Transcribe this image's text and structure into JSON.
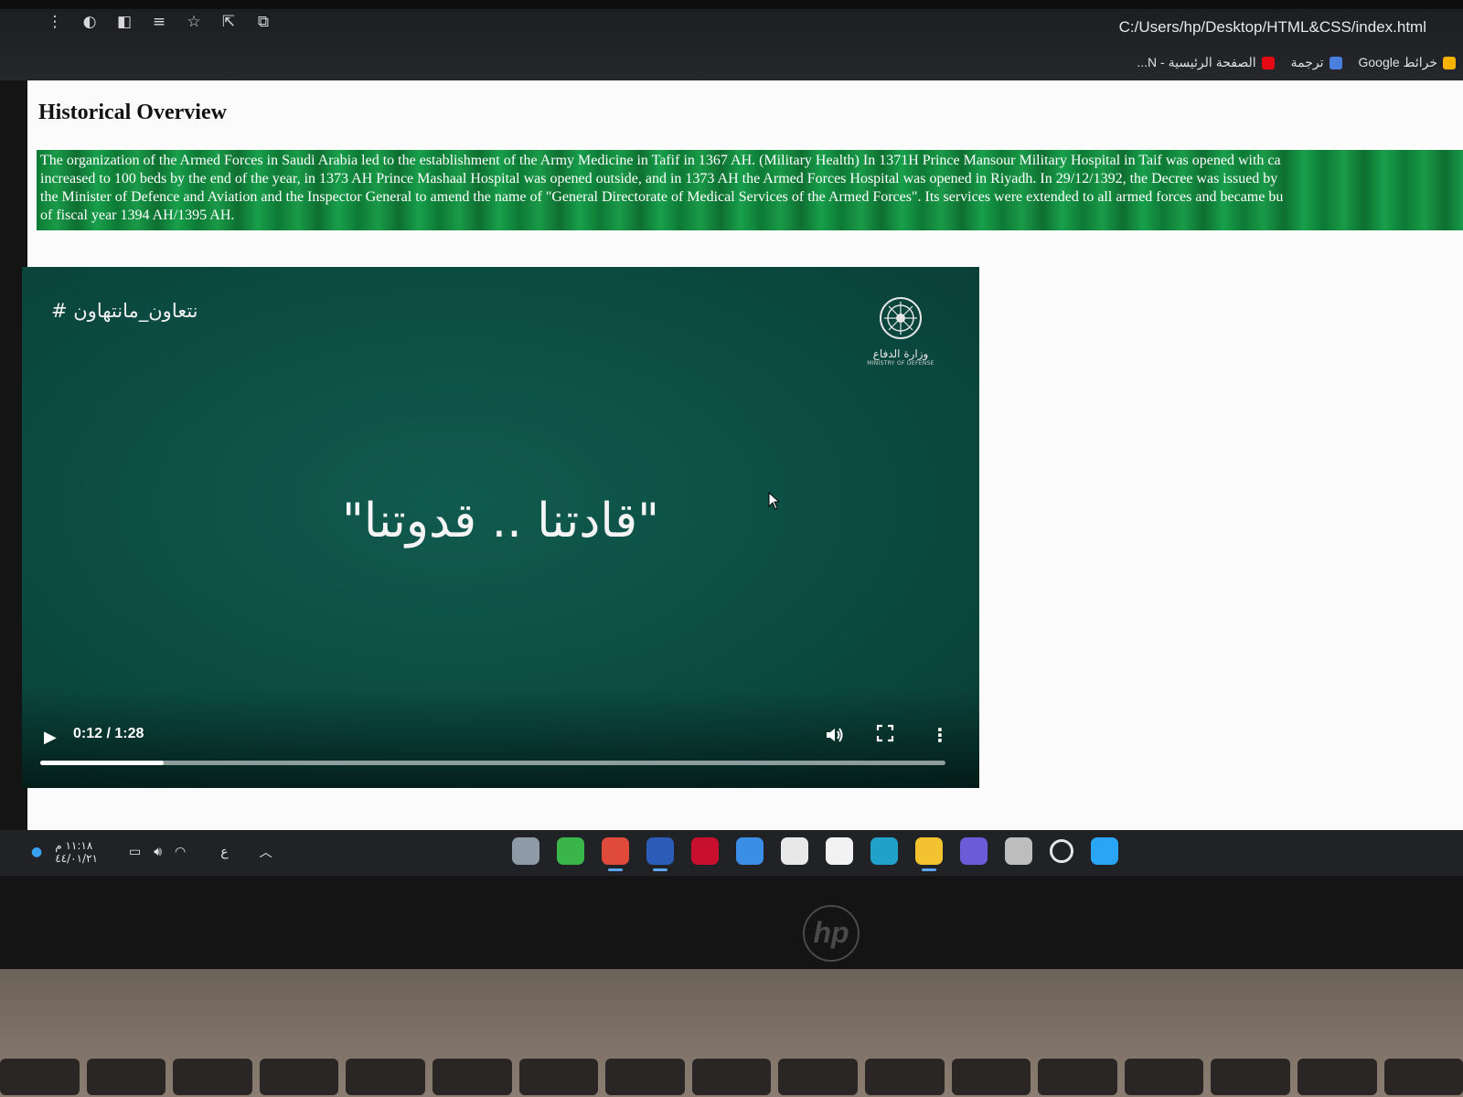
{
  "browser": {
    "address": "C:/Users/hp/Desktop/HTML&CSS/index.html",
    "bookmarks": [
      {
        "label": "خرائط Google",
        "color": "#f4b400"
      },
      {
        "label": "ترجمة",
        "color": "#4a7fe0"
      },
      {
        "label": "الصفحة الرئيسية - N...",
        "color": "#e50914"
      }
    ]
  },
  "page": {
    "heading": "Historical Overview",
    "paragraph": "The organization of the Armed Forces in Saudi Arabia led to the establishment of the Army Medicine in Tafif in 1367 AH. (Military Health) In 1371H Prince Mansour Military Hospital in Taif was opened with ca\nincreased to 100 beds by the end of the year, in 1373 AH Prince Mashaal Hospital was opened outside, and in 1373 AH the Armed Forces Hospital was opened in Riyadh. In 29/12/1392, the Decree was issued by\nthe Minister of Defence and Aviation and the Inspector General to amend the name of \"General Directorate of Medical Services of the Armed Forces\". Its services were extended to all armed forces and became bu\nof fiscal year 1394 AH/1395 AH."
  },
  "video": {
    "hashtag": "# نتعاون_مانتهاون",
    "emblem_arabic": "وزارة الدفاع",
    "emblem_english": "MINISTRY OF DEFENSE",
    "quote": "\"قادتنا .. قدوتنا\"",
    "time": "0:12 / 1:28",
    "progress": 0.136
  },
  "taskbar": {
    "clock_time": "١١:١٨ م",
    "clock_date": "٤٤/٠١/٢١",
    "input_language": "ع",
    "apps": [
      {
        "name": "settings",
        "color": "#8e9aa6"
      },
      {
        "name": "green-app",
        "color": "#39b54a"
      },
      {
        "name": "chrome",
        "color": "#e04a3a",
        "active": true
      },
      {
        "name": "word",
        "color": "#2b5cb8",
        "active": true
      },
      {
        "name": "mcafee",
        "color": "#c8102e"
      },
      {
        "name": "help",
        "color": "#3a8ee6"
      },
      {
        "name": "app-white",
        "color": "#e8e8e8"
      },
      {
        "name": "store",
        "color": "#f2f2f2"
      },
      {
        "name": "edge",
        "color": "#1fa1c9"
      },
      {
        "name": "file-explorer",
        "color": "#f2c230",
        "active": true
      },
      {
        "name": "chat",
        "color": "#6b5bd6"
      },
      {
        "name": "task-view",
        "color": "#bdbdbd"
      },
      {
        "name": "search",
        "color": "#202226"
      },
      {
        "name": "start",
        "color": "#2aa4f4"
      }
    ]
  }
}
